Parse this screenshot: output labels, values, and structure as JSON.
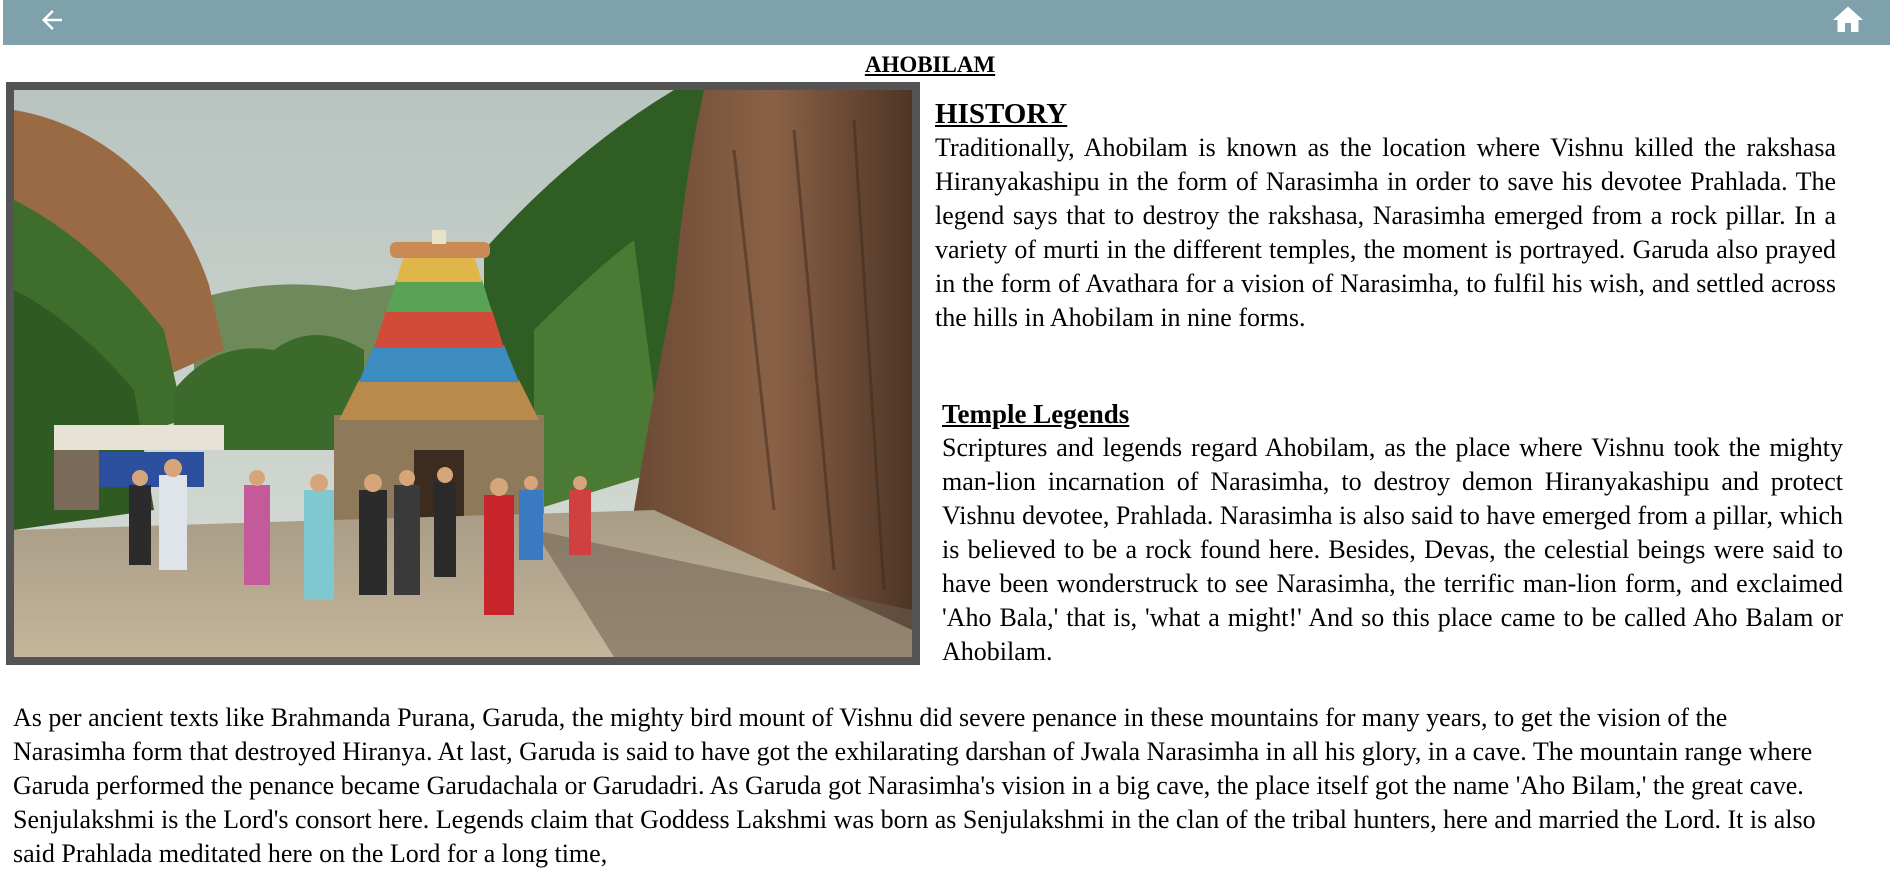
{
  "header": {
    "back_icon": "arrow-left-icon",
    "home_icon": "home-icon",
    "bar_color": "#7ea1ab"
  },
  "page": {
    "title": "AHOBILAM"
  },
  "image": {
    "subject": "temple-gopuram-photo"
  },
  "history": {
    "heading": "HISTORY",
    "text": "Traditionally, Ahobilam is known as the location where Vishnu killed the rakshasa Hiranyakashipu in the form of Narasimha in order to save his devotee Prahlada. The legend says that to destroy the rakshasa, Narasimha emerged from a rock pillar. In a variety of murti in the different temples, the moment is portrayed. Garuda also prayed in the form of Avathara for a vision of Narasimha, to fulfil his wish, and settled across the hills in Ahobilam in nine forms."
  },
  "legends": {
    "heading": "Temple Legends",
    "text": "Scriptures and legends regard Ahobilam, as the place where Vishnu took the mighty man-lion incarnation of Narasimha, to destroy demon Hiranyakashipu and protect Vishnu devotee, Prahlada. Narasimha is also said to have emerged from a pillar, which is believed to be a rock found here. Besides, Devas, the celestial beings were said to have been wonderstruck to see Narasimha, the terrific man-lion form, and exclaimed 'Aho Bala,' that is, 'what a might!' And so this place came to be called Aho Balam or Ahobilam."
  },
  "continued": {
    "text": "As per ancient texts like Brahmanda Purana, Garuda, the mighty bird mount of Vishnu did severe penance in these mountains for many years, to get the vision of the Narasimha form that destroyed Hiranya. At last, Garuda is said to have got the exhilarating darshan of Jwala Narasimha in all his glory, in a cave. The mountain range where Garuda performed the penance became Garudachala or Garudadri. As Garuda got Narasimha's vision in a big cave, the place itself got the name 'Aho Bilam,' the great cave. Senjulakshmi is the Lord's consort here. Legends claim that Goddess Lakshmi was born as Senjulakshmi in the clan of the tribal hunters, here and married the Lord. It is also said Prahlada meditated here on the Lord for a long time,"
  }
}
